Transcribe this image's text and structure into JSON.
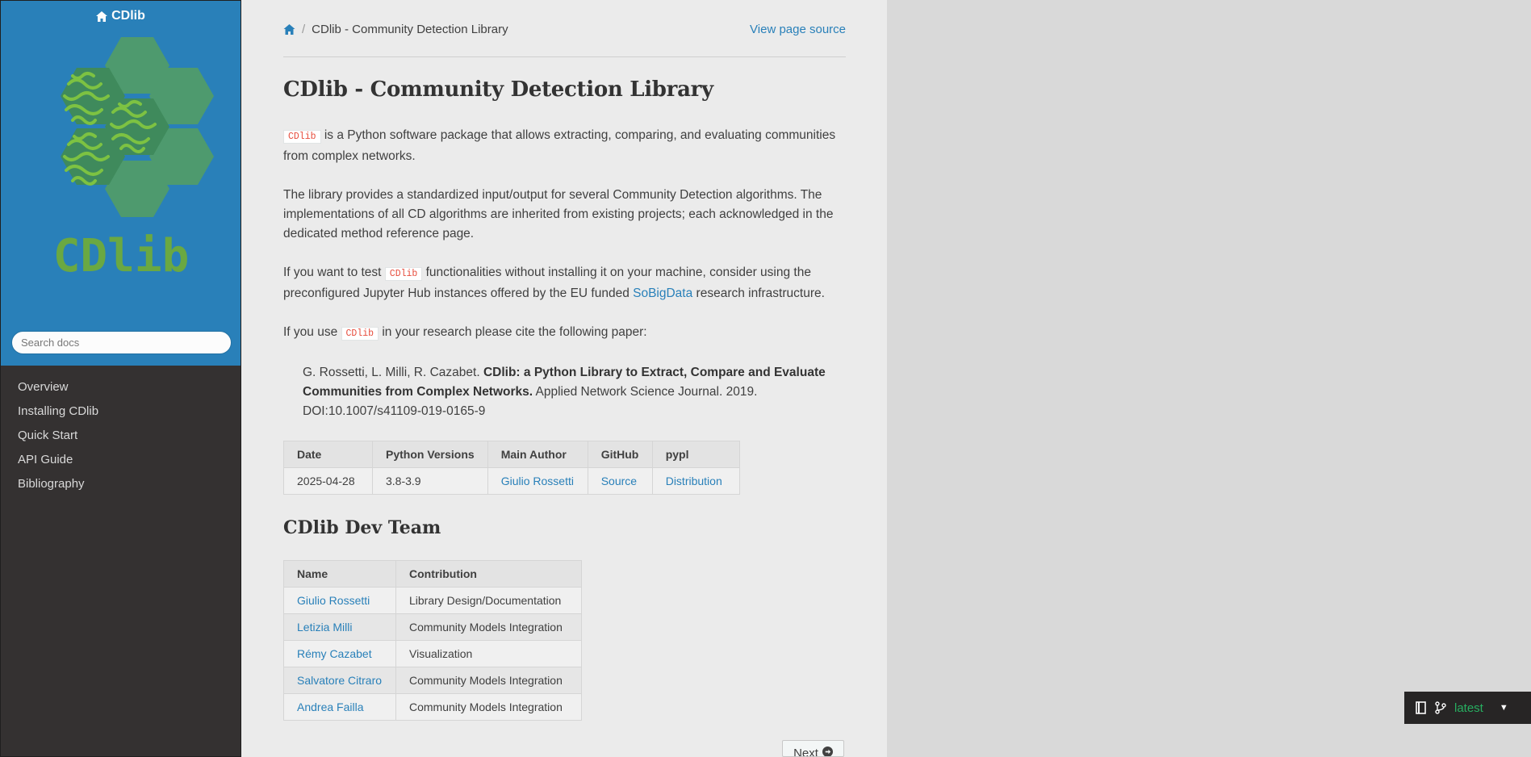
{
  "sidebar": {
    "brand": "CDlib",
    "logo_text": "CDlib",
    "search_placeholder": "Search docs",
    "nav": [
      "Overview",
      "Installing CDlib",
      "Quick Start",
      "API Guide",
      "Bibliography"
    ]
  },
  "breadcrumb": {
    "current": "CDlib - Community Detection Library",
    "view_source": "View page source"
  },
  "page": {
    "title": "CDlib - Community Detection Library",
    "p1_code": "CDlib",
    "p1_text": " is a Python software package that allows extracting, comparing, and evaluating communities from complex networks.",
    "p2": "The library provides a standardized input/output for several Community Detection algorithms. The implementations of all CD algorithms are inherited from existing projects; each acknowledged in the dedicated method reference page.",
    "p3_a": "If you want to test ",
    "p3_code": "CDlib",
    "p3_b": " functionalities without installing it on your machine, consider using the preconfigured Jupyter Hub instances offered by the EU funded ",
    "p3_link": "SoBigData",
    "p3_c": " research infrastructure.",
    "p4_a": "If you use ",
    "p4_code": "CDlib",
    "p4_b": " in your research please cite the following paper:",
    "cite_authors": "G. Rossetti, L. Milli, R. Cazabet. ",
    "cite_title": "CDlib: a Python Library to Extract, Compare and Evaluate Communities from Complex Networks.",
    "cite_rest": " Applied Network Science Journal. 2019. DOI:10.1007/s41109-019-0165-9"
  },
  "info_table": {
    "headers": [
      "Date",
      "Python Versions",
      "Main Author",
      "GitHub",
      "pypl"
    ],
    "row": [
      "2025-04-28",
      "3.8-3.9",
      "Giulio Rossetti",
      "Source",
      "Distribution"
    ]
  },
  "team": {
    "heading": "CDlib Dev Team",
    "headers": [
      "Name",
      "Contribution"
    ],
    "rows": [
      [
        "Giulio Rossetti",
        "Library Design/Documentation"
      ],
      [
        "Letizia Milli",
        "Community Models Integration"
      ],
      [
        "Rémy Cazabet",
        "Visualization"
      ],
      [
        "Salvatore Citraro",
        "Community Models Integration"
      ],
      [
        "Andrea Failla",
        "Community Models Integration"
      ]
    ]
  },
  "footer_nav": {
    "next": "Next"
  },
  "versions": {
    "current": "latest"
  },
  "colors": {
    "sidebar_top": "#2980b9",
    "sidebar_bottom": "#343131",
    "link": "#2980b9",
    "code": "#e74c3c",
    "logo_green": "#6aa842",
    "hex_green": "#4e9a6e",
    "version_green": "#27ae60"
  },
  "icons": [
    "home-icon",
    "book-icon",
    "git-branch-icon",
    "caret-down-icon",
    "arrow-circle-right-icon"
  ]
}
